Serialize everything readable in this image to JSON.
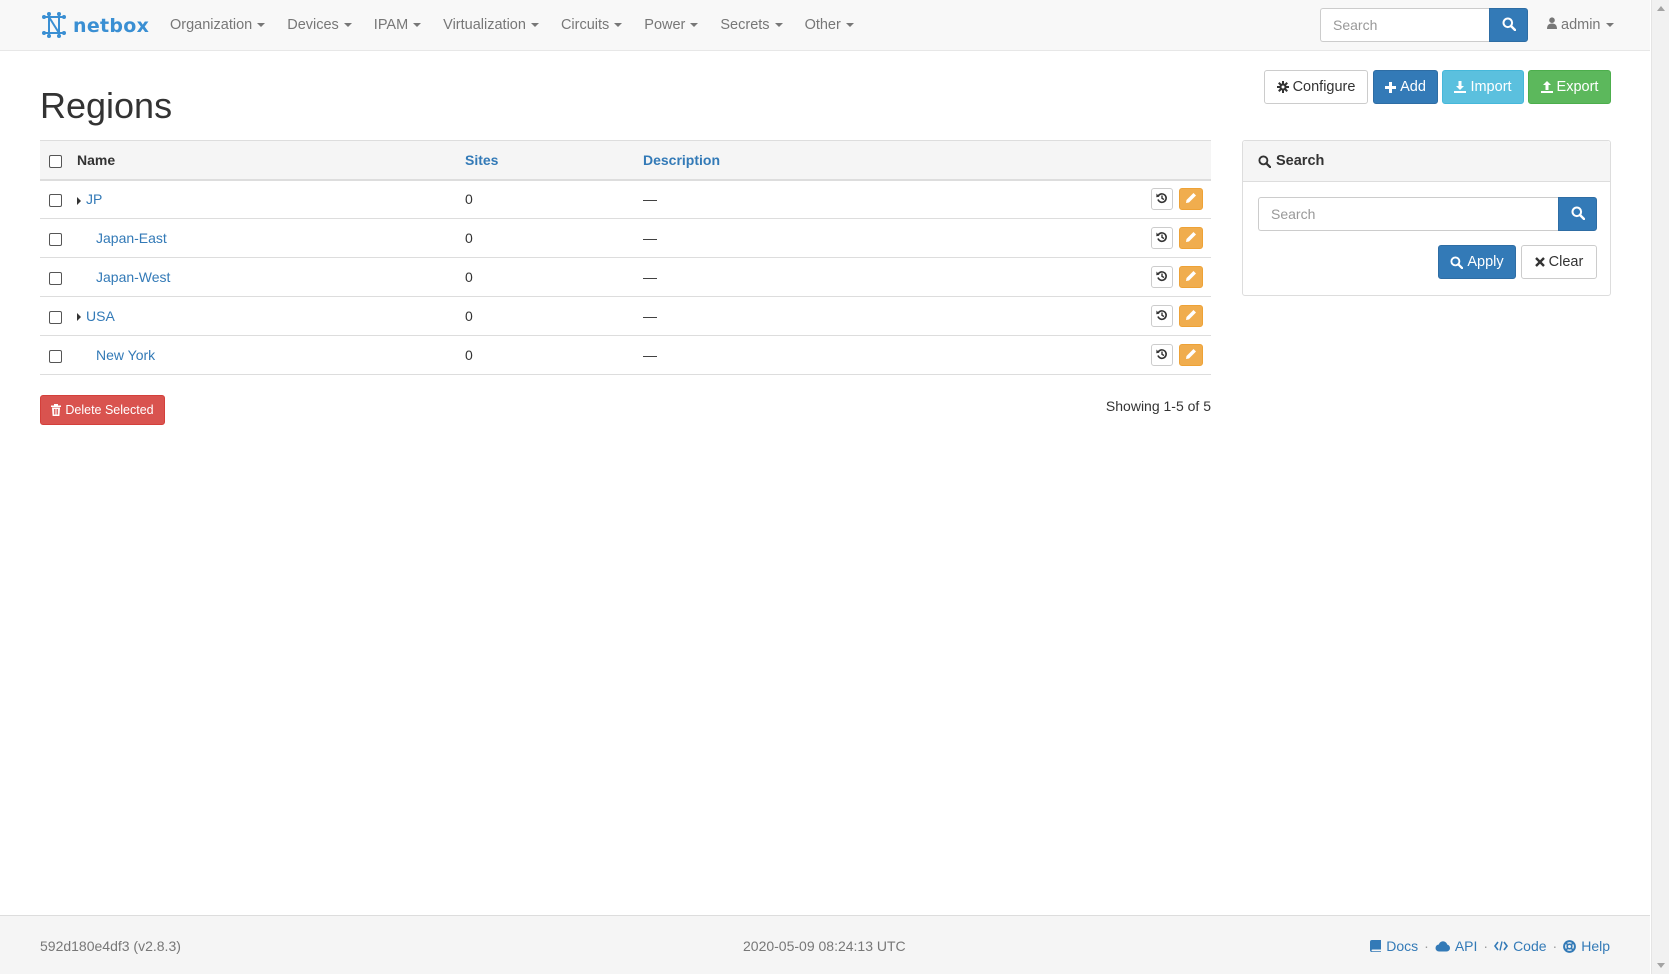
{
  "navbar": {
    "brand": "netbox",
    "menu": [
      {
        "label": "Organization"
      },
      {
        "label": "Devices"
      },
      {
        "label": "IPAM"
      },
      {
        "label": "Virtualization"
      },
      {
        "label": "Circuits"
      },
      {
        "label": "Power"
      },
      {
        "label": "Secrets"
      },
      {
        "label": "Other"
      }
    ],
    "search_placeholder": "Search",
    "user": "admin"
  },
  "page": {
    "title": "Regions",
    "actions": {
      "configure": "Configure",
      "add": "Add",
      "import": "Import",
      "export": "Export"
    }
  },
  "table": {
    "columns": [
      "Name",
      "Sites",
      "Description"
    ],
    "rows": [
      {
        "name": "JP",
        "sites": "0",
        "description": "—",
        "expandable": true
      },
      {
        "name": "Japan-East",
        "sites": "0",
        "description": "—",
        "expandable": false
      },
      {
        "name": "Japan-West",
        "sites": "0",
        "description": "—",
        "expandable": false
      },
      {
        "name": "USA",
        "sites": "0",
        "description": "—",
        "expandable": true
      },
      {
        "name": "New York",
        "sites": "0",
        "description": "—",
        "expandable": false
      }
    ],
    "delete_selected": "Delete Selected",
    "showing": "Showing 1-5 of 5"
  },
  "search_panel": {
    "title": "Search",
    "placeholder": "Search",
    "apply": "Apply",
    "clear": "Clear"
  },
  "footer": {
    "version": "592d180e4df3 (v2.8.3)",
    "timestamp": "2020-05-09 08:24:13 UTC",
    "links": {
      "docs": "Docs",
      "api": "API",
      "code": "Code",
      "help": "Help"
    }
  },
  "colors": {
    "primary": "#337ab7",
    "info": "#5bc0de",
    "success": "#5cb85c",
    "danger": "#d9534f",
    "warning": "#f0ad4e",
    "brand": "#3a8fd3"
  }
}
